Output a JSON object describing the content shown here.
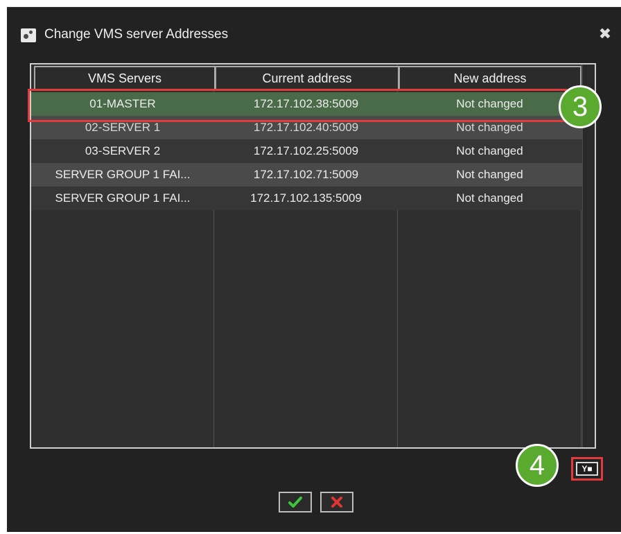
{
  "window": {
    "title": "Change VMS server Addresses",
    "close_glyph": "✖"
  },
  "table": {
    "headers": [
      "VMS Servers",
      "Current address",
      "New address"
    ],
    "rows": [
      {
        "server": "01-MASTER",
        "current": "172.17.102.38:5009",
        "new": "Not changed",
        "selected": true
      },
      {
        "server": "02-SERVER 1",
        "current": "172.17.102.40:5009",
        "new": "Not changed",
        "selected": false
      },
      {
        "server": "03-SERVER 2",
        "current": "172.17.102.25:5009",
        "new": "Not changed",
        "selected": false
      },
      {
        "server": "SERVER GROUP 1 FAI...",
        "current": "172.17.102.71:5009",
        "new": "Not changed",
        "selected": false
      },
      {
        "server": "SERVER GROUP 1 FAI...",
        "current": "172.17.102.135:5009",
        "new": "Not changed",
        "selected": false
      }
    ]
  },
  "callouts": [
    "3",
    "4"
  ],
  "edit_button": {
    "label": "Y■"
  },
  "buttons": {
    "ok_icon": "check-icon",
    "cancel_icon": "x-icon"
  },
  "colors": {
    "selected_row": "#4a6b48",
    "highlight": "#e23b3b",
    "callout": "#5aaa2f",
    "ok": "#3cc43c",
    "cancel": "#e03535"
  }
}
